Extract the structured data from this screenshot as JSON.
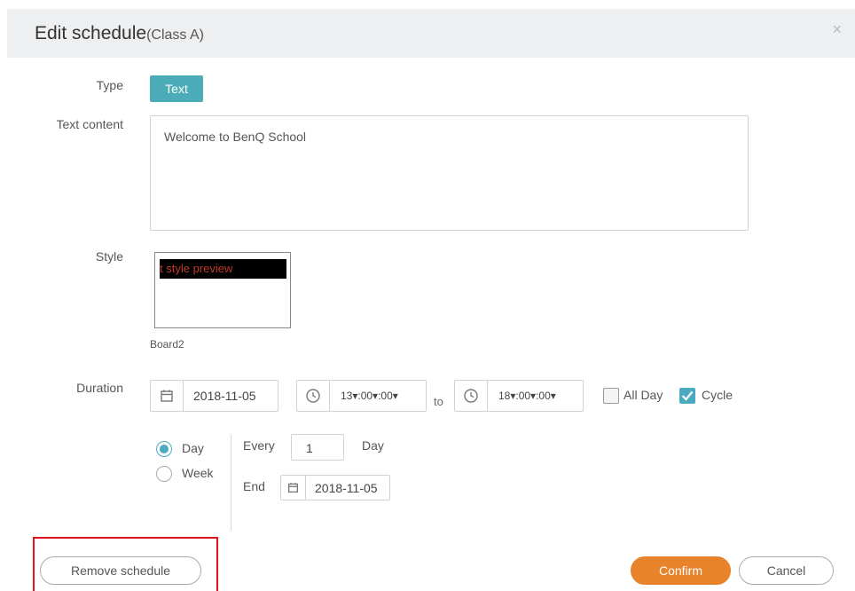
{
  "dialog": {
    "title": "Edit schedule",
    "subtitle": "(Class A)",
    "close_glyph": "×"
  },
  "form": {
    "type_label": "Type",
    "type_value": "Text",
    "text_content_label": "Text content",
    "text_content_value": "Welcome to BenQ School",
    "style_label": "Style",
    "style_preview_text": "t style preview",
    "style_preview_colors": {
      "background": "#000000",
      "text": "#c23a2a"
    },
    "board_name": "Board2",
    "duration_label": "Duration",
    "start_date": "2018-11-05",
    "start_time": "13▾:00▾:00▾",
    "to_label": "to",
    "end_time": "18▾:00▾:00▾",
    "all_day_label": "All Day",
    "all_day_checked": false,
    "cycle_label": "Cycle",
    "cycle_checked": true
  },
  "recurrence": {
    "options": [
      {
        "label": "Day",
        "selected": true
      },
      {
        "label": "Week",
        "selected": false
      }
    ],
    "every_label": "Every",
    "every_value": "1",
    "every_unit": "Day",
    "end_label": "End",
    "end_date": "2018-11-05"
  },
  "footer": {
    "remove_label": "Remove schedule",
    "confirm_label": "Confirm",
    "cancel_label": "Cancel"
  },
  "icons": {
    "calendar": "calendar-icon",
    "clock": "clock-icon",
    "close": "close-icon",
    "checkmark": "checkmark-icon"
  },
  "colors": {
    "accent": "#4bacb8",
    "confirm": "#e8822b",
    "highlight_box": "#e3121b"
  }
}
